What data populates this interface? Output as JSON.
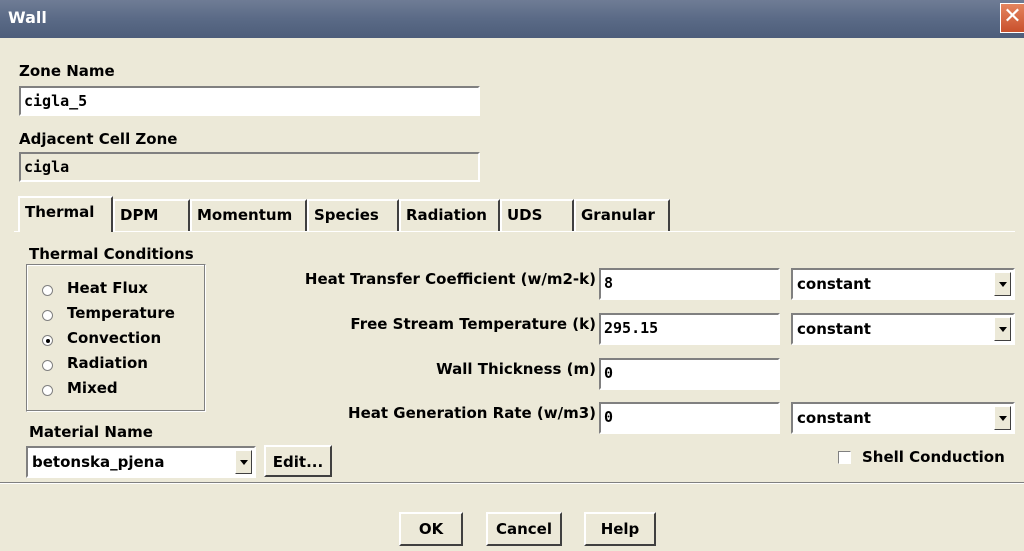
{
  "window": {
    "title": "Wall",
    "close_glyph": "✕"
  },
  "zone_name": {
    "label": "Zone Name",
    "value": "cigla_5"
  },
  "adjacent_cell_zone": {
    "label": "Adjacent Cell Zone",
    "value": "cigla"
  },
  "tabs": [
    {
      "label": "Thermal",
      "active": true
    },
    {
      "label": "DPM"
    },
    {
      "label": "Momentum"
    },
    {
      "label": "Species"
    },
    {
      "label": "Radiation"
    },
    {
      "label": "UDS"
    },
    {
      "label": "Granular"
    }
  ],
  "thermal_conditions": {
    "label": "Thermal Conditions",
    "options": [
      "Heat Flux",
      "Temperature",
      "Convection",
      "Radiation",
      "Mixed"
    ],
    "selected": "Convection"
  },
  "material": {
    "label": "Material Name",
    "value": "betonska_pjena",
    "edit_label": "Edit..."
  },
  "params": {
    "heat_transfer_coefficient": {
      "label": "Heat Transfer Coefficient (w/m2-k)",
      "value": "8",
      "method": "constant"
    },
    "free_stream_temperature": {
      "label": "Free Stream Temperature (k)",
      "value": "295.15",
      "method": "constant"
    },
    "wall_thickness": {
      "label": "Wall Thickness (m)",
      "value": "0"
    },
    "heat_generation_rate": {
      "label": "Heat Generation Rate (w/m3)",
      "value": "0",
      "method": "constant"
    }
  },
  "shell_conduction": {
    "label": "Shell Conduction",
    "checked": false
  },
  "buttons": {
    "ok": "OK",
    "cancel": "Cancel",
    "help": "Help"
  },
  "icons": {
    "close": "close-icon",
    "dropdown": "chevron-down-icon"
  }
}
